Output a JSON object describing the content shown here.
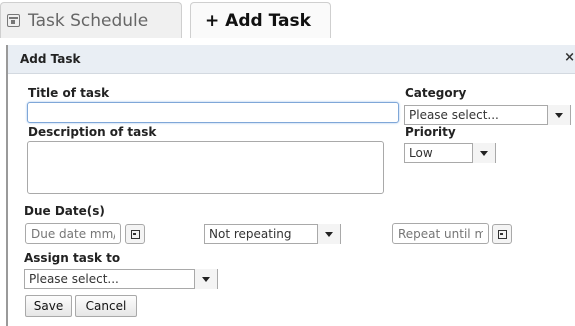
{
  "tabs": [
    {
      "label": "Task Schedule",
      "icon": "calendar-icon"
    },
    {
      "label": "+ Add Task",
      "icon": "plus-icon"
    }
  ],
  "dialog": {
    "title": "Add Task",
    "close": "×",
    "fields": {
      "title_label": "Title of task",
      "title_value": "",
      "category_label": "Category",
      "category_value": "Please select...",
      "description_label": "Description of task",
      "description_value": "",
      "priority_label": "Priority",
      "priority_value": "Low",
      "due_label": "Due Date(s)",
      "due_placeholder": "Due date mm/",
      "repeat_value": "Not repeating",
      "repeat_until_placeholder": "Repeat until m",
      "assign_label": "Assign task to",
      "assign_value": "Please select..."
    },
    "buttons": {
      "save": "Save",
      "cancel": "Cancel"
    }
  }
}
